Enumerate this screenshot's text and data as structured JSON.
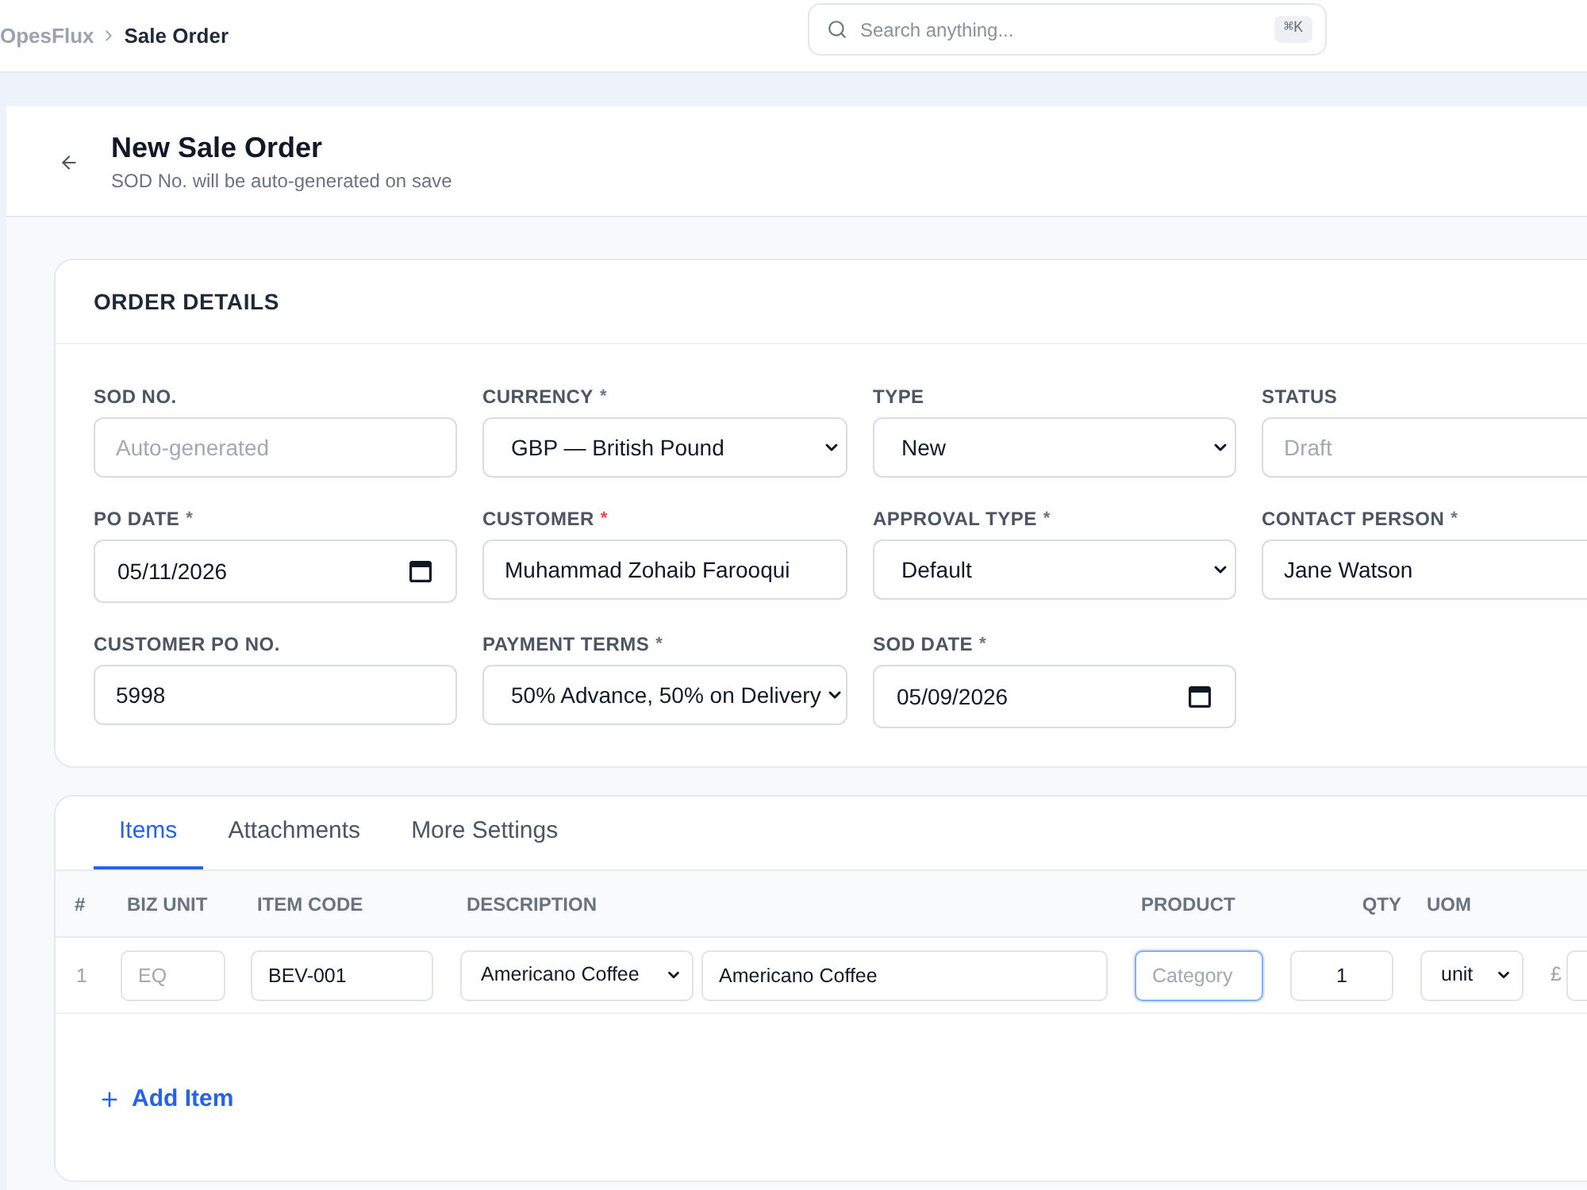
{
  "topbar": {
    "breadcrumb": [
      {
        "label": "OpesFlux",
        "current": false
      },
      {
        "label": "Sale Order",
        "current": true
      }
    ],
    "search": {
      "placeholder": "Search anything...",
      "shortcut": "⌘K"
    }
  },
  "header": {
    "title": "New Sale Order",
    "subtitle": "SOD No. will be auto-generated on save"
  },
  "order_details": {
    "title": "ORDER DETAILS",
    "fields": [
      {
        "label": "SOD NO.",
        "kind": "text",
        "placeholder": "Auto-generated"
      },
      {
        "label": "CURRENCY",
        "mark": "*",
        "mark_alert": false,
        "kind": "select",
        "value": "GBP — British Pound"
      },
      {
        "label": "TYPE",
        "kind": "select",
        "value": "New"
      },
      {
        "label": "STATUS",
        "kind": "text",
        "placeholder": "Draft"
      },
      {
        "label": "PO DATE",
        "mark": "*",
        "mark_alert": false,
        "kind": "date",
        "value": "05/11/2026"
      },
      {
        "label": "CUSTOMER",
        "mark": "*",
        "mark_alert": true,
        "kind": "text",
        "value": "Muhammad Zohaib Farooqui"
      },
      {
        "label": "APPROVAL TYPE",
        "mark": "*",
        "mark_alert": false,
        "kind": "select",
        "value": "Default"
      },
      {
        "label": "CONTACT PERSON",
        "mark": "*",
        "mark_alert": false,
        "kind": "text",
        "value": "Jane Watson"
      },
      {
        "label": "CUSTOMER PO NO.",
        "kind": "text",
        "value": "5998"
      },
      {
        "label": "PAYMENT TERMS",
        "mark": "*",
        "mark_alert": false,
        "kind": "select",
        "value": "50% Advance, 50% on Delivery"
      },
      {
        "label": "SOD DATE",
        "mark": "*",
        "mark_alert": false,
        "kind": "date",
        "value": "05/09/2026"
      }
    ]
  },
  "tabs": [
    {
      "label": "Items",
      "selected": true
    },
    {
      "label": "Attachments",
      "selected": false
    },
    {
      "label": "More Settings",
      "selected": false
    }
  ],
  "items_table": {
    "columns": [
      "#",
      "BIZ UNIT",
      "ITEM CODE",
      "DESCRIPTION",
      "PRODUCT",
      "QTY",
      "UOM"
    ],
    "rows": [
      {
        "number": "1",
        "biz_unit": {
          "placeholder": "EQ"
        },
        "item_code": {
          "value": "BEV-001"
        },
        "item_select": {
          "value": "Americano Coffee"
        },
        "description": {
          "value": "Americano Coffee"
        },
        "product": {
          "placeholder": "Category",
          "focused": true
        },
        "qty": {
          "value": "1"
        },
        "uom": {
          "value": "unit"
        },
        "price_currency": "£"
      }
    ]
  },
  "add_item": {
    "label": "Add Item"
  }
}
